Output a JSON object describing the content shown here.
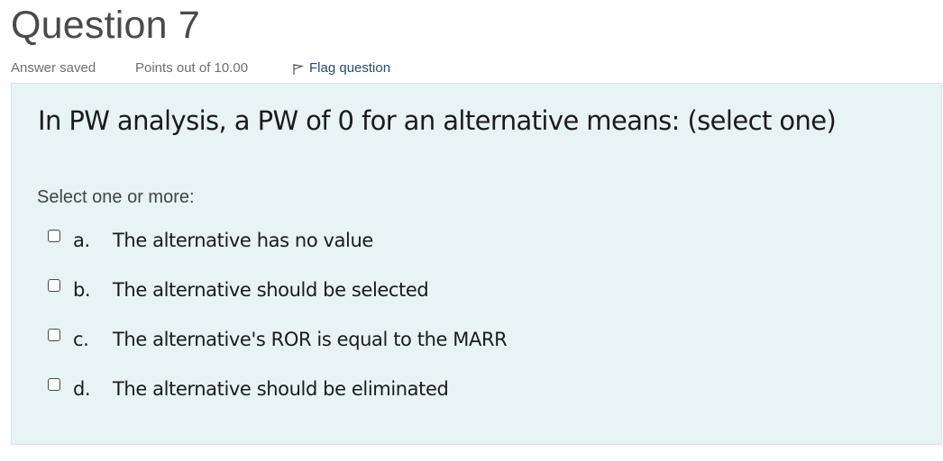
{
  "question": {
    "title": "Question 7",
    "state": "Answer saved",
    "grade": "Points out of 10.00",
    "flag_label": "Flag question",
    "flag_icon": "flag-icon"
  },
  "formulation": {
    "text": "In PW analysis, a PW of 0 for an alternative means: (select one)",
    "prompt": "Select one or more:",
    "background_color": "#e7f3f5",
    "answers": [
      {
        "number": "a.",
        "label": "The alternative has no value",
        "checked": false
      },
      {
        "number": "b.",
        "label": "The alternative should be selected",
        "checked": false
      },
      {
        "number": "c.",
        "label": "The alternative's ROR is equal to the MARR",
        "checked": false
      },
      {
        "number": "d.",
        "label": "The alternative should be eliminated",
        "checked": false
      }
    ]
  }
}
